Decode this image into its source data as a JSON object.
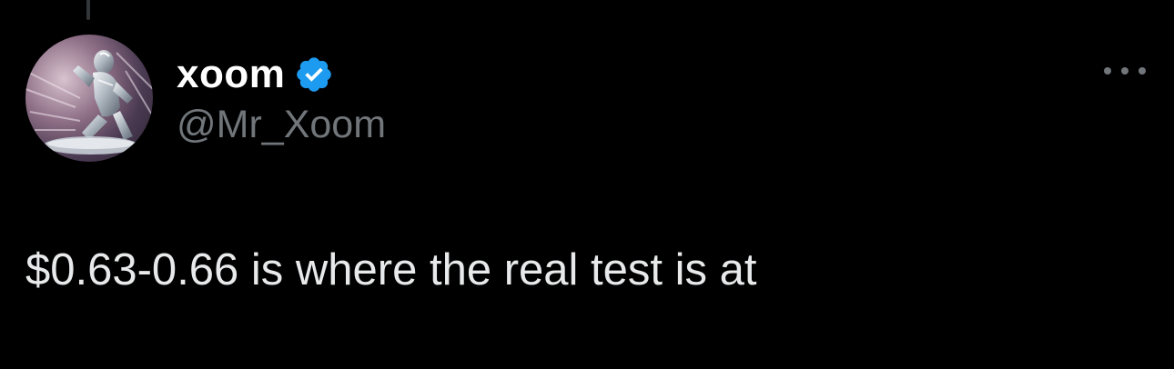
{
  "tweet": {
    "author": {
      "display_name": "xoom",
      "handle": "@Mr_Xoom",
      "verified": true,
      "avatar_icon": "silver-surfer-avatar"
    },
    "text": "$0.63-0.66 is where the real test is at"
  },
  "colors": {
    "background": "#000000",
    "primary_text": "#e7e9ea",
    "secondary_text": "#71767b",
    "verified_blue": "#1d9bf0"
  },
  "icons": {
    "more": "more-options-icon",
    "verified": "verified-badge-icon"
  }
}
